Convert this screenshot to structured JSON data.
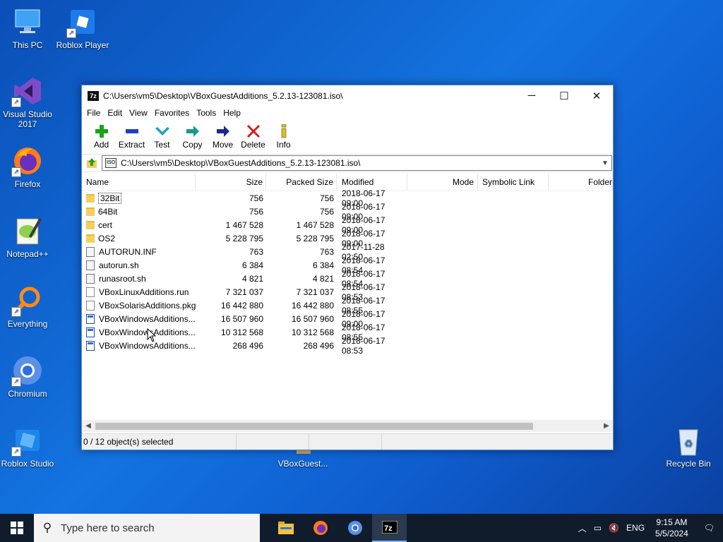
{
  "desktop": {
    "icons": [
      {
        "label": "This PC"
      },
      {
        "label": "Roblox Player"
      },
      {
        "label": "Visual Studio 2017"
      },
      {
        "label": "Firefox"
      },
      {
        "label": "Notepad++"
      },
      {
        "label": "Everything"
      },
      {
        "label": "Chromium"
      },
      {
        "label": "Roblox Studio"
      },
      {
        "label": "VBoxGuest..."
      },
      {
        "label": "Recycle Bin"
      }
    ]
  },
  "window": {
    "title": "C:\\Users\\vm5\\Desktop\\VBoxGuestAdditions_5.2.13-123081.iso\\",
    "app_icon": "7z",
    "controls": {
      "minimize": "─",
      "maximize": "☐",
      "close": "✕"
    },
    "menu": [
      "File",
      "Edit",
      "View",
      "Favorites",
      "Tools",
      "Help"
    ],
    "toolbar": [
      {
        "label": "Add",
        "icon": "plus-icon",
        "color": "#1aa31a"
      },
      {
        "label": "Extract",
        "icon": "minus-icon",
        "color": "#1f3fbf"
      },
      {
        "label": "Test",
        "icon": "check-icon",
        "color": "#22a0c0"
      },
      {
        "label": "Copy",
        "icon": "arrow-icon",
        "color": "#1a9a8a"
      },
      {
        "label": "Move",
        "icon": "arrow-icon",
        "color": "#1a2a8a"
      },
      {
        "label": "Delete",
        "icon": "x-icon",
        "color": "#d21a1a"
      },
      {
        "label": "Info",
        "icon": "info-icon",
        "color": "#d6c21a"
      }
    ],
    "address": "C:\\Users\\vm5\\Desktop\\VBoxGuestAdditions_5.2.13-123081.iso\\",
    "address_icon": "ISO",
    "columns": [
      "Name",
      "Size",
      "Packed Size",
      "Modified",
      "Mode",
      "Symbolic Link",
      "Folder"
    ],
    "files": [
      {
        "name": "32Bit",
        "size": "756",
        "packed": "756",
        "modified": "2018-06-17 09:00",
        "type": "folder"
      },
      {
        "name": "64Bit",
        "size": "756",
        "packed": "756",
        "modified": "2018-06-17 09:00",
        "type": "folder"
      },
      {
        "name": "cert",
        "size": "1 467 528",
        "packed": "1 467 528",
        "modified": "2018-06-17 09:00",
        "type": "folder"
      },
      {
        "name": "OS2",
        "size": "5 228 795",
        "packed": "5 228 795",
        "modified": "2018-06-17 09:00",
        "type": "folder"
      },
      {
        "name": "AUTORUN.INF",
        "size": "763",
        "packed": "763",
        "modified": "2017-11-28 02:50",
        "type": "script"
      },
      {
        "name": "autorun.sh",
        "size": "6 384",
        "packed": "6 384",
        "modified": "2018-06-17 08:54",
        "type": "script"
      },
      {
        "name": "runasroot.sh",
        "size": "4 821",
        "packed": "4 821",
        "modified": "2018-06-17 08:54",
        "type": "script"
      },
      {
        "name": "VBoxLinuxAdditions.run",
        "size": "7 321 037",
        "packed": "7 321 037",
        "modified": "2018-06-17 08:53",
        "type": "file"
      },
      {
        "name": "VBoxSolarisAdditions.pkg",
        "size": "16 442 880",
        "packed": "16 442 880",
        "modified": "2018-06-17 08:55",
        "type": "file"
      },
      {
        "name": "VBoxWindowsAdditions...",
        "size": "16 507 960",
        "packed": "16 507 960",
        "modified": "2018-06-17 09:00",
        "type": "exe"
      },
      {
        "name": "VBoxWindowsAdditions...",
        "size": "10 312 568",
        "packed": "10 312 568",
        "modified": "2018-06-17 08:55",
        "type": "exe"
      },
      {
        "name": "VBoxWindowsAdditions...",
        "size": "268 496",
        "packed": "268 496",
        "modified": "2018-06-17 08:53",
        "type": "exe"
      }
    ],
    "status": "0 / 12 object(s) selected"
  },
  "taskbar": {
    "search_placeholder": "Type here to search",
    "apps": [
      "file-explorer",
      "firefox",
      "chromium",
      "7-zip"
    ],
    "tray": {
      "language": "ENG",
      "time": "9:15 AM",
      "date": "5/5/2024"
    }
  }
}
